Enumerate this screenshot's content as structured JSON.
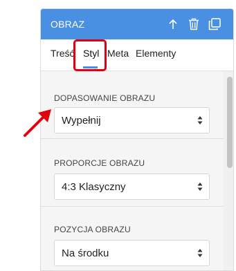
{
  "header": {
    "title": "OBRAZ",
    "icons": [
      "arrow-up-icon",
      "trash-icon",
      "duplicate-icon"
    ],
    "color": "#4a90e2"
  },
  "tabs": [
    {
      "label": "Treść"
    },
    {
      "label": "Styl",
      "active": true
    },
    {
      "label": "Meta"
    },
    {
      "label": "Elementy"
    }
  ],
  "sections": [
    {
      "label": "DOPASOWANIE OBRAZU",
      "value": "Wypełnij"
    },
    {
      "label": "PROPORCJE OBRAZU",
      "value": "4:3 Klasyczny"
    },
    {
      "label": "POZYCJA OBRAZU",
      "value": "Na środku"
    }
  ],
  "annotation": {
    "highlight_color": "#e00010"
  }
}
